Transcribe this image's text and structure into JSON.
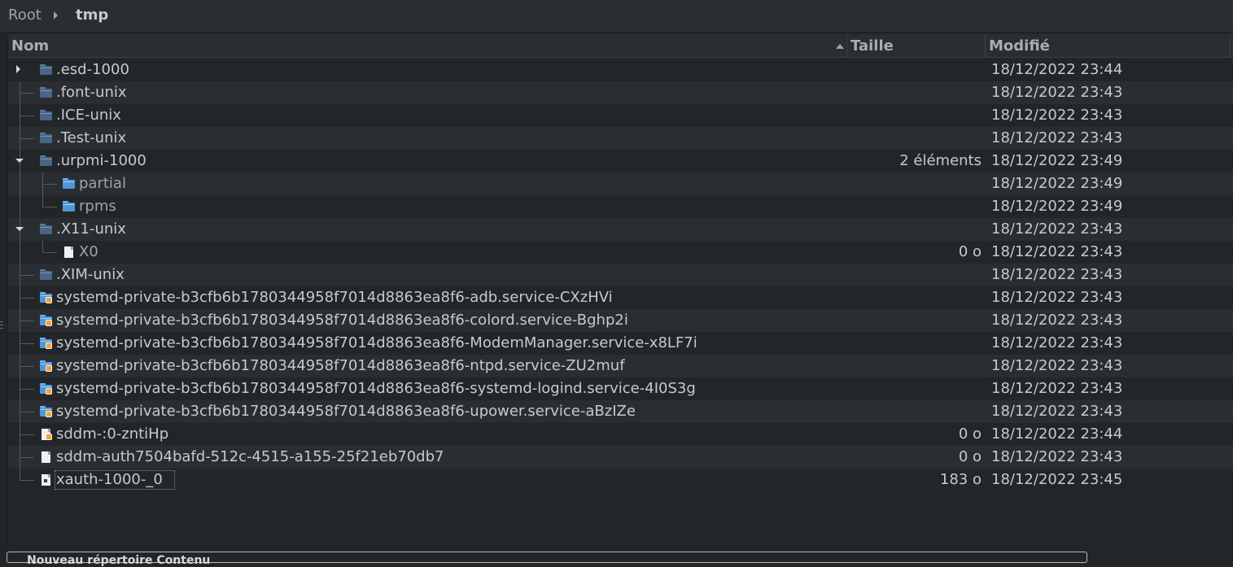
{
  "breadcrumb": {
    "root": "Root",
    "current": "tmp"
  },
  "header": {
    "name": "Nom",
    "size": "Taille",
    "modified": "Modifié"
  },
  "rows": [
    {
      "name": ".esd-1000",
      "size": "",
      "date": "18/12/2022 23:44"
    },
    {
      "name": ".font-unix",
      "size": "",
      "date": "18/12/2022 23:43"
    },
    {
      "name": ".ICE-unix",
      "size": "",
      "date": "18/12/2022 23:43"
    },
    {
      "name": ".Test-unix",
      "size": "",
      "date": "18/12/2022 23:43"
    },
    {
      "name": ".urpmi-1000",
      "size": "2 éléments",
      "date": "18/12/2022 23:49"
    },
    {
      "name": "partial",
      "size": "",
      "date": "18/12/2022 23:49"
    },
    {
      "name": "rpms",
      "size": "",
      "date": "18/12/2022 23:49"
    },
    {
      "name": ".X11-unix",
      "size": "",
      "date": "18/12/2022 23:43"
    },
    {
      "name": "X0",
      "size": "0 o",
      "date": "18/12/2022 23:43"
    },
    {
      "name": ".XIM-unix",
      "size": "",
      "date": "18/12/2022 23:43"
    },
    {
      "name": "systemd-private-b3cfb6b1780344958f7014d8863ea8f6-adb.service-CXzHVi",
      "size": "",
      "date": "18/12/2022 23:43"
    },
    {
      "name": "systemd-private-b3cfb6b1780344958f7014d8863ea8f6-colord.service-Bghp2i",
      "size": "",
      "date": "18/12/2022 23:43"
    },
    {
      "name": "systemd-private-b3cfb6b1780344958f7014d8863ea8f6-ModemManager.service-x8LF7i",
      "size": "",
      "date": "18/12/2022 23:43"
    },
    {
      "name": "systemd-private-b3cfb6b1780344958f7014d8863ea8f6-ntpd.service-ZU2muf",
      "size": "",
      "date": "18/12/2022 23:43"
    },
    {
      "name": "systemd-private-b3cfb6b1780344958f7014d8863ea8f6-systemd-logind.service-4I0S3g",
      "size": "",
      "date": "18/12/2022 23:43"
    },
    {
      "name": "systemd-private-b3cfb6b1780344958f7014d8863ea8f6-upower.service-aBzIZe",
      "size": "",
      "date": "18/12/2022 23:43"
    },
    {
      "name": "sddm-:0-zntiHp",
      "size": "0 o",
      "date": "18/12/2022 23:44"
    },
    {
      "name": "sddm-auth7504bafd-512c-4515-a155-25f21eb70db7",
      "size": "0 o",
      "date": "18/12/2022 23:43"
    },
    {
      "name": "xauth-1000-_0",
      "size": "183 o",
      "date": "18/12/2022 23:45"
    }
  ],
  "bottom_panel": {
    "label": "Nouveau répertoire Contenu"
  },
  "colors": {
    "background": "#232629",
    "alt_row": "#2a2e32",
    "text": "#c7c9cc",
    "folder": "#4a6585",
    "folder_light": "#4f97d6",
    "lock_badge": "#f2a33a"
  }
}
